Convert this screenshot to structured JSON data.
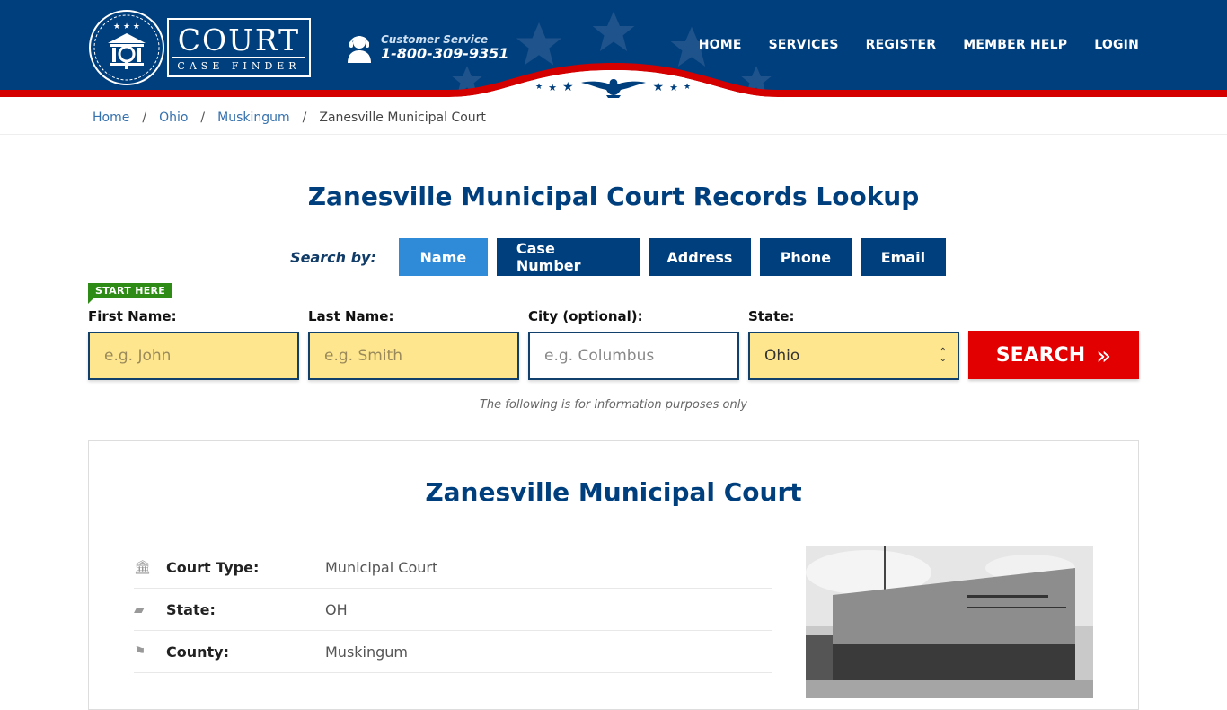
{
  "header": {
    "logo": {
      "title": "COURT",
      "subtitle": "CASE FINDER"
    },
    "customer_service": {
      "label": "Customer Service",
      "phone": "1-800-309-9351"
    },
    "nav": [
      "HOME",
      "SERVICES",
      "REGISTER",
      "MEMBER HELP",
      "LOGIN"
    ]
  },
  "breadcrumb": {
    "items": [
      "Home",
      "Ohio",
      "Muskingum"
    ],
    "current": "Zanesville Municipal Court",
    "separator": "/"
  },
  "page_title": "Zanesville Municipal Court Records Lookup",
  "search": {
    "label": "Search by:",
    "tabs": [
      "Name",
      "Case Number",
      "Address",
      "Phone",
      "Email"
    ],
    "active_tab": "Name",
    "badge": "START HERE",
    "fields": {
      "first_name": {
        "label": "First Name:",
        "placeholder": "e.g. John"
      },
      "last_name": {
        "label": "Last Name:",
        "placeholder": "e.g. Smith"
      },
      "city": {
        "label": "City (optional):",
        "placeholder": "e.g.  Columbus"
      },
      "state": {
        "label": "State:",
        "value": "Ohio"
      }
    },
    "button": "SEARCH",
    "button_icon": "»",
    "note": "The following is for information purposes only"
  },
  "court": {
    "name": "Zanesville Municipal Court",
    "rows": [
      {
        "icon": "courthouse-icon",
        "glyph": "🏛",
        "key": "Court Type:",
        "value": "Municipal Court"
      },
      {
        "icon": "usa-map-icon",
        "glyph": "▰",
        "key": "State:",
        "value": "OH"
      },
      {
        "icon": "flag-icon",
        "glyph": "⚑",
        "key": "County:",
        "value": "Muskingum"
      }
    ]
  },
  "colors": {
    "brand_blue": "#003f7d",
    "active_tab": "#2f8ad8",
    "search_red": "#e20000",
    "start_green": "#2e8b16",
    "input_yellow": "#fde68d"
  }
}
